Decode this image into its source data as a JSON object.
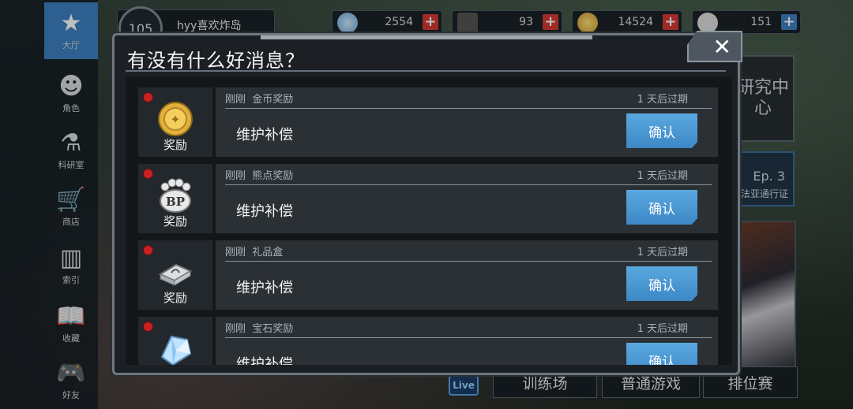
{
  "sidebar": {
    "items": [
      {
        "label": "大厅",
        "icon": "star-icon",
        "active": true
      },
      {
        "label": "角色",
        "icon": "character-icon"
      },
      {
        "label": "科研室",
        "icon": "flask-icon"
      },
      {
        "label": "商店",
        "icon": "cart-icon"
      },
      {
        "label": "索引",
        "icon": "books-icon"
      },
      {
        "label": "收藏",
        "icon": "book-icon"
      },
      {
        "label": "好友",
        "icon": "gamepad-icon"
      }
    ]
  },
  "player": {
    "level": "105",
    "name": "hyy喜欢炸岛"
  },
  "resources": [
    {
      "icon": "diamond-icon",
      "value": "2554"
    },
    {
      "icon": "ticket-icon",
      "value": "93"
    },
    {
      "icon": "gold-coin-icon",
      "value": "14524"
    },
    {
      "icon": "bp-paw-icon",
      "value": "151"
    }
  ],
  "right_panel": {
    "research": "研究中心",
    "pass_ep": "Ep. 3",
    "pass_label": "法亚通行证"
  },
  "bottom": {
    "training": "训练场",
    "normal": "普通游戏",
    "ranked": "排位赛",
    "live": "Live"
  },
  "modal": {
    "title": "有没有什么好消息？",
    "close_glyph": "✕",
    "messages": [
      {
        "time": "刚刚",
        "subject": "金币奖励",
        "expire": "1 天后过期",
        "body": "维护补偿",
        "kind": "奖励",
        "confirm": "确认",
        "icon": "gold-coin-icon"
      },
      {
        "time": "刚刚",
        "subject": "熊点奖励",
        "expire": "1 天后过期",
        "body": "维护补偿",
        "kind": "奖励",
        "confirm": "确认",
        "icon": "bp-paw-icon"
      },
      {
        "time": "刚刚",
        "subject": "礼品盒",
        "expire": "1 天后过期",
        "body": "维护补偿",
        "kind": "奖励",
        "confirm": "确认",
        "icon": "gift-box-icon"
      },
      {
        "time": "刚刚",
        "subject": "宝石奖励",
        "expire": "1 天后过期",
        "body": "维护补偿",
        "kind": "",
        "confirm": "确认",
        "icon": "diamond-icon"
      }
    ]
  },
  "colors": {
    "accent": "#3d88c5",
    "notify": "#c9221f",
    "plus": "#d53a35"
  }
}
